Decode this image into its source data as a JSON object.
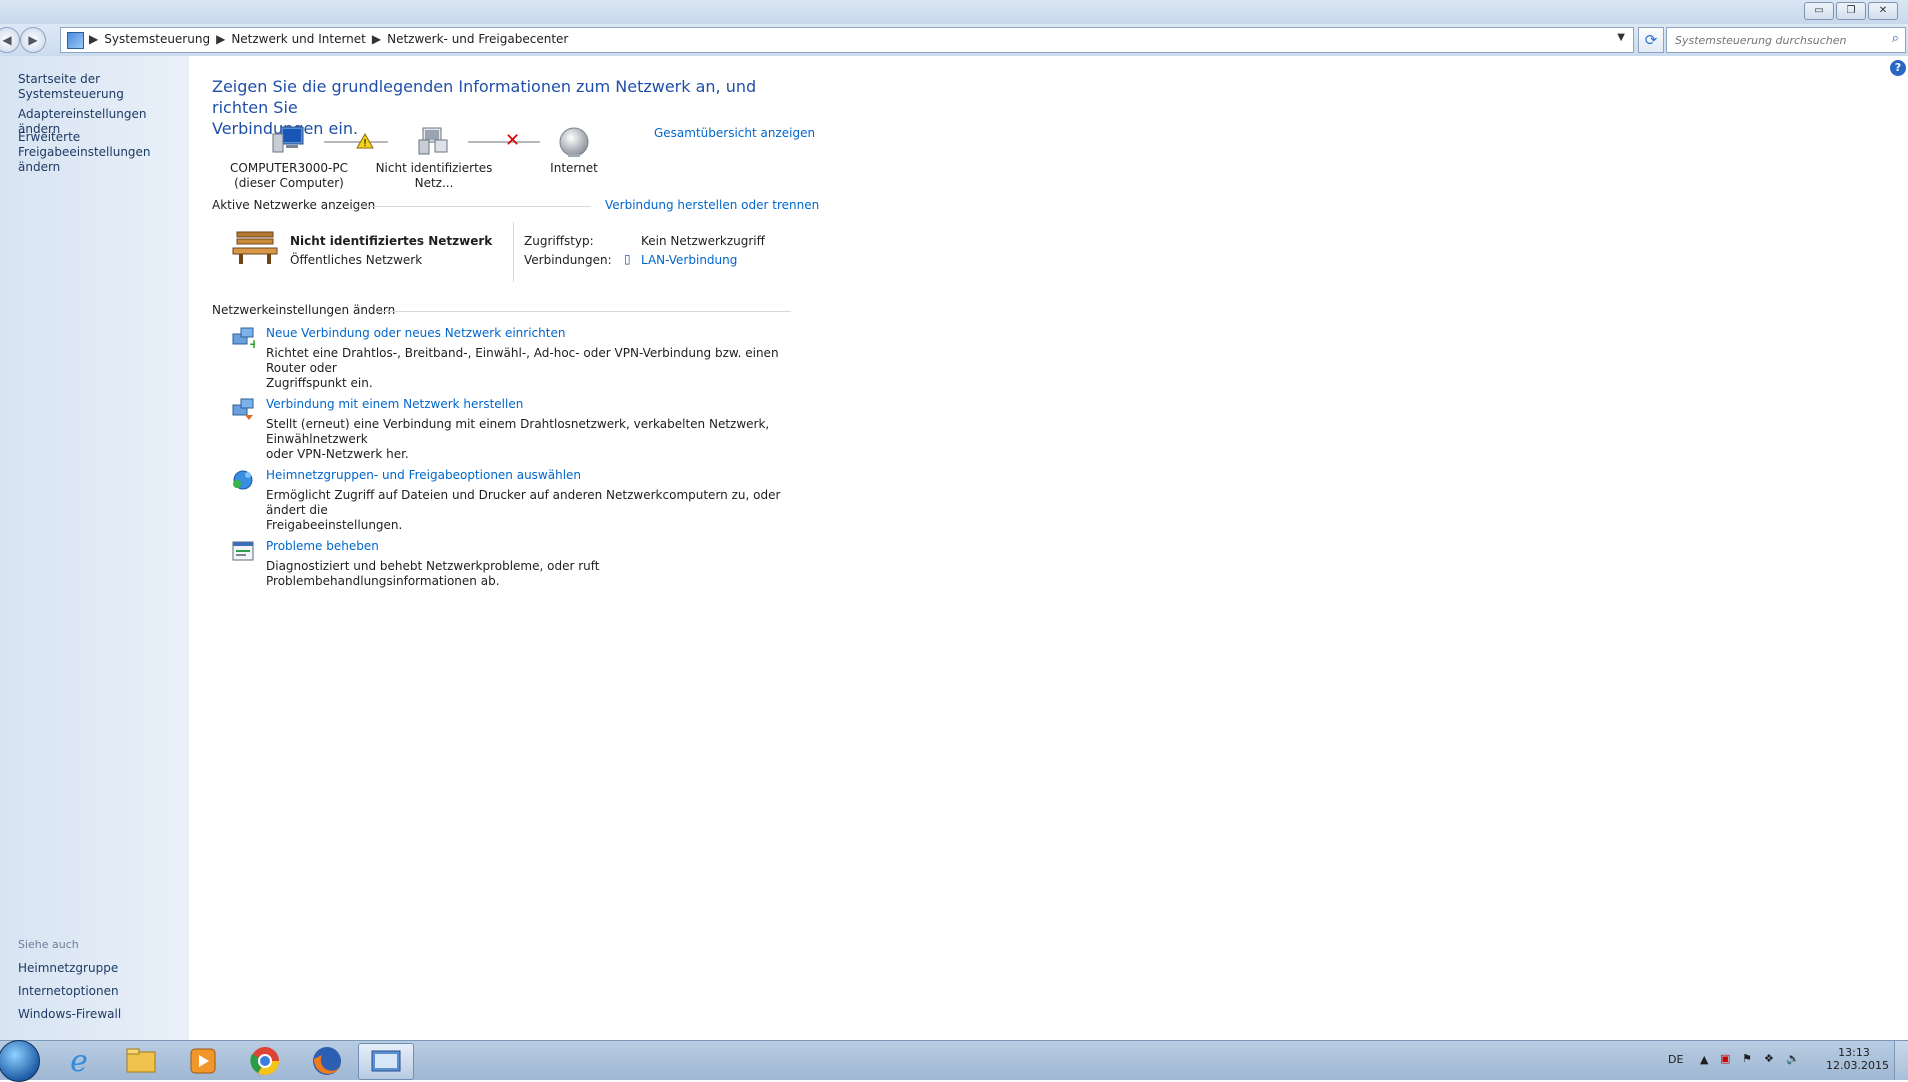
{
  "window": {
    "minimize_glyph": "▭",
    "restore_glyph": "❐",
    "close_glyph": "✕"
  },
  "address": {
    "crumbs": [
      "Systemsteuerung",
      "Netzwerk und Internet",
      "Netzwerk- und Freigabecenter"
    ],
    "search_placeholder": "Systemsteuerung durchsuchen"
  },
  "sidebar": {
    "items": [
      "Startseite der Systemsteuerung",
      "Adaptereinstellungen ändern",
      "Erweiterte",
      "Freigabeeinstellungen ändern"
    ],
    "see_also_heading": "Siehe auch",
    "see_also": [
      "Heimnetzgruppe",
      "Internetoptionen",
      "Windows-Firewall"
    ]
  },
  "main": {
    "title_line1": "Zeigen Sie die grundlegenden Informationen zum Netzwerk an, und richten Sie",
    "title_line2": "Verbindungen ein.",
    "full_map_link": "Gesamtübersicht anzeigen",
    "network_map": {
      "computer_name": "COMPUTER3000-PC",
      "computer_sub": "(dieser Computer)",
      "network_name": "Nicht identifiziertes Netz...",
      "internet": "Internet"
    },
    "active_networks": {
      "heading": "Aktive Netzwerke anzeigen",
      "connect_link": "Verbindung herstellen oder trennen",
      "network_title": "Nicht identifiziertes Netzwerk",
      "network_type": "Öffentliches Netzwerk",
      "access_type_label": "Zugriffstyp:",
      "access_type_value": "Kein Netzwerkzugriff",
      "connections_label": "Verbindungen:",
      "connections_value": "LAN-Verbindung"
    },
    "change_settings": {
      "heading": "Netzwerkeinstellungen ändern",
      "tasks": [
        {
          "title": "Neue Verbindung oder neues Netzwerk einrichten",
          "desc_line1": "Richtet eine Drahtlos-, Breitband-, Einwähl-, Ad-hoc- oder VPN-Verbindung bzw. einen Router oder",
          "desc_line2": "Zugriffspunkt ein.",
          "icon": "new-connection-icon"
        },
        {
          "title": "Verbindung mit einem Netzwerk herstellen",
          "desc_line1": "Stellt (erneut) eine Verbindung mit einem Drahtlosnetzwerk, verkabelten Netzwerk, Einwählnetzwerk",
          "desc_line2": "oder VPN-Netzwerk her.",
          "icon": "connect-network-icon"
        },
        {
          "title": "Heimnetzgruppen- und Freigabeoptionen auswählen",
          "desc_line1": "Ermöglicht Zugriff auf Dateien und Drucker auf anderen Netzwerkcomputern zu, oder ändert die",
          "desc_line2": "Freigabeeinstellungen.",
          "icon": "homegroup-icon"
        },
        {
          "title": "Probleme beheben",
          "desc_line1": "Diagnostiziert und behebt Netzwerkprobleme, oder ruft Problembehandlungsinformationen ab.",
          "desc_line2": "",
          "icon": "troubleshoot-icon"
        }
      ]
    }
  },
  "taskbar": {
    "language": "DE",
    "time": "13:13",
    "date": "12.03.2015"
  },
  "colors": {
    "link": "#0066cc",
    "title": "#1f4fa8",
    "sidebar_bg": "#dfe9f5",
    "taskbar_bg": "#a9bfd9"
  }
}
